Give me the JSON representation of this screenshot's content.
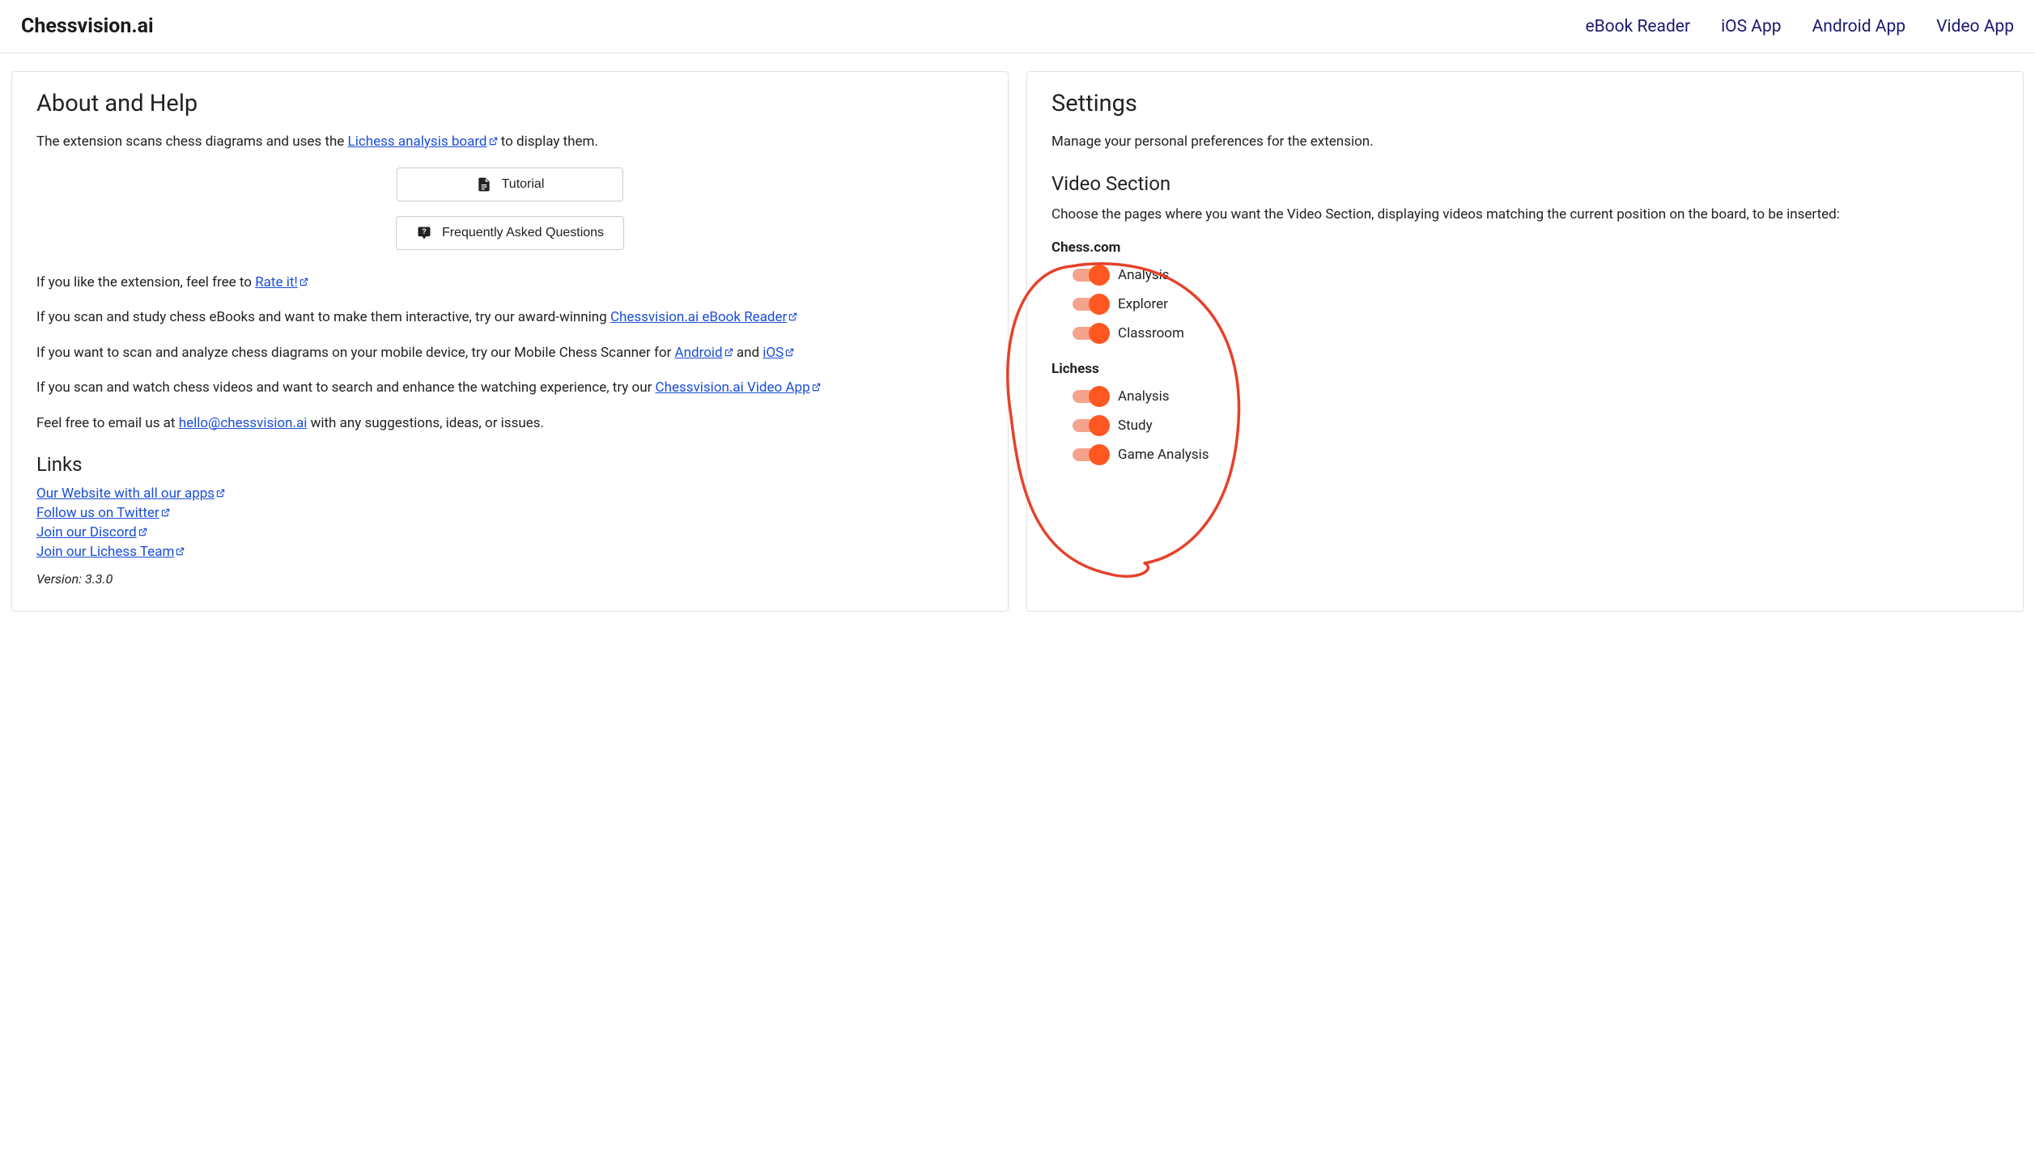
{
  "header": {
    "brand": "Chessvision.ai",
    "nav": [
      {
        "label": "eBook Reader"
      },
      {
        "label": "iOS App"
      },
      {
        "label": "Android App"
      },
      {
        "label": "Video App"
      }
    ]
  },
  "about": {
    "title": "About and Help",
    "intro_pre": "The extension scans chess diagrams and uses the ",
    "intro_link": "Lichess analysis board",
    "intro_post": " to display them.",
    "tutorial_btn": "Tutorial",
    "faq_btn": "Frequently Asked Questions",
    "rate_pre": "If you like the extension, feel free to ",
    "rate_link": "Rate it!",
    "ebook_pre": "If you scan and study chess eBooks and want to make them interactive, try our award-winning ",
    "ebook_link": "Chessvision.ai eBook Reader",
    "mobile_pre": "If you want to scan and analyze chess diagrams on your mobile device, try our Mobile Chess Scanner for ",
    "mobile_android": "Android",
    "mobile_and": " and ",
    "mobile_ios": "iOS",
    "video_pre": "If you scan and watch chess videos and want to search and enhance the watching experience, try our ",
    "video_link": "Chessvision.ai Video App",
    "email_pre": "Feel free to email us at ",
    "email_link": "hello@chessvision.ai",
    "email_post": " with any suggestions, ideas, or issues.",
    "links_title": "Links",
    "links": [
      {
        "label": "Our Website with all our apps"
      },
      {
        "label": "Follow us on Twitter"
      },
      {
        "label": "Join our Discord"
      },
      {
        "label": "Join our Lichess Team"
      }
    ],
    "version": "Version: 3.3.0"
  },
  "settings": {
    "title": "Settings",
    "subtitle": "Manage your personal preferences for the extension.",
    "video_title": "Video Section",
    "video_desc": "Choose the pages where you want the Video Section, displaying videos matching the current position on the board, to be inserted:",
    "groups": [
      {
        "label": "Chess.com",
        "items": [
          {
            "label": "Analysis",
            "on": true
          },
          {
            "label": "Explorer",
            "on": true
          },
          {
            "label": "Classroom",
            "on": true
          }
        ]
      },
      {
        "label": "Lichess",
        "items": [
          {
            "label": "Analysis",
            "on": true
          },
          {
            "label": "Study",
            "on": true
          },
          {
            "label": "Game Analysis",
            "on": true
          }
        ]
      }
    ]
  }
}
